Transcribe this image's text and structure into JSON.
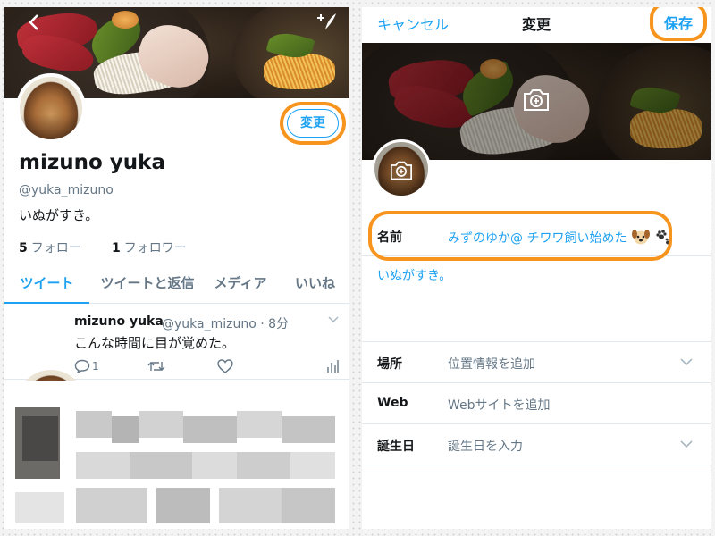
{
  "profile_view": {
    "back_icon": "chevron-left-icon",
    "compose_icon": "compose-tweet-icon",
    "edit_button_label": "変更",
    "display_name": "mizuno yuka",
    "handle": "@yuka_mizuno",
    "bio": "いぬがすき。",
    "following_count": "5",
    "following_label": "フォロー",
    "followers_count": "1",
    "followers_label": "フォロワー",
    "tabs": [
      {
        "label": "ツイート",
        "active": true
      },
      {
        "label": "ツイートと返信",
        "active": false
      },
      {
        "label": "メディア",
        "active": false
      },
      {
        "label": "いいね",
        "active": false
      }
    ],
    "tweet": {
      "name": "mizuno yuka",
      "meta": "@yuka_mizuno · 8分",
      "text": "こんな時間に目が覚めた。",
      "reply_count": "1"
    }
  },
  "edit_view": {
    "cancel_label": "キャンセル",
    "title": "変更",
    "save_label": "保存",
    "name_label": "名前",
    "name_value": "みずのゆか@ チワワ飼い始めた",
    "bio_value": "いぬがすき。",
    "fields": [
      {
        "label": "場所",
        "placeholder": "位置情報を追加",
        "chevron": true
      },
      {
        "label": "Web",
        "placeholder": "Webサイトを追加",
        "chevron": false
      },
      {
        "label": "誕生日",
        "placeholder": "誕生日を入力",
        "chevron": true
      }
    ]
  },
  "colors": {
    "accent": "#1da1f2",
    "highlight": "#f7941d",
    "text_primary": "#14171a",
    "text_secondary": "#657786"
  }
}
